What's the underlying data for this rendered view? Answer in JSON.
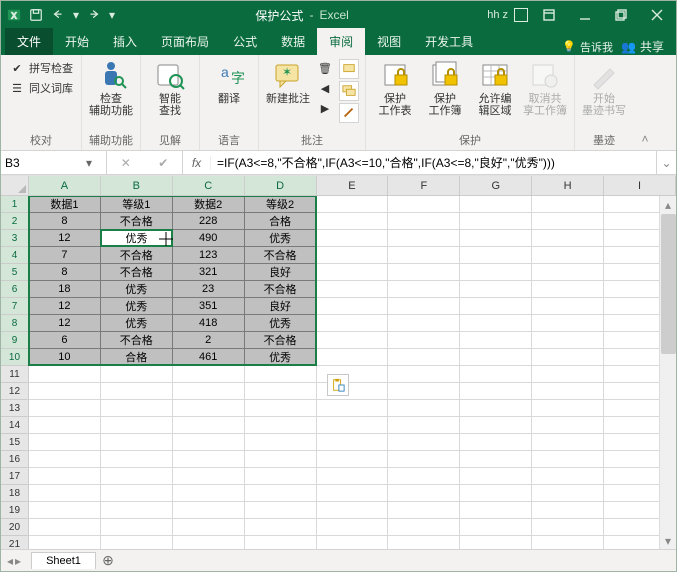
{
  "title": {
    "doc": "保护公式",
    "app": "Excel"
  },
  "user": "hh z",
  "qat": {
    "save": "save",
    "undo": "undo",
    "redo": "redo"
  },
  "win": {
    "min": "minimize",
    "max": "restore",
    "close": "close"
  },
  "tabs": {
    "file": "文件",
    "home": "开始",
    "insert": "插入",
    "layout": "页面布局",
    "formulas": "公式",
    "data": "数据",
    "review": "审阅",
    "view": "视图",
    "devtools": "开发工具",
    "tellme": "告诉我",
    "share": "共享"
  },
  "ribbon": {
    "proofing": {
      "label": "校对",
      "spelling": "拼写检查",
      "thesaurus": "同义词库"
    },
    "accessibility": {
      "label": "辅助功能",
      "check1": "检查",
      "check2": "辅助功能"
    },
    "insights": {
      "label": "见解",
      "smart1": "智能",
      "smart2": "查找"
    },
    "language": {
      "label": "语言",
      "translate": "翻译"
    },
    "comments": {
      "label": "批注",
      "new": "新建批注"
    },
    "protect": {
      "label": "保护",
      "sheet1": "保护",
      "sheet2": "工作表",
      "book1": "保护",
      "book2": "工作簿",
      "allow1": "允许编",
      "allow2": "辑区域",
      "unshare1": "取消共",
      "unshare2": "享工作簿"
    },
    "ink": {
      "label": "墨迹",
      "start1": "开始",
      "start2": "墨迹书写"
    }
  },
  "namebox": "B3",
  "formula": "=IF(A3<=8,\"不合格\",IF(A3<=10,\"合格\",IF(A3<=8,\"良好\",\"优秀\")))",
  "columns": [
    "A",
    "B",
    "C",
    "D",
    "E",
    "F",
    "G",
    "H",
    "I"
  ],
  "sel_cols": 4,
  "sel_rows": 10,
  "active": {
    "row": 3,
    "col": "B",
    "value": "优秀"
  },
  "table": [
    [
      "数据1",
      "等级1",
      "数据2",
      "等级2"
    ],
    [
      "8",
      "不合格",
      "228",
      "合格"
    ],
    [
      "12",
      "优秀",
      "490",
      "优秀"
    ],
    [
      "7",
      "不合格",
      "123",
      "不合格"
    ],
    [
      "8",
      "不合格",
      "321",
      "良好"
    ],
    [
      "18",
      "优秀",
      "23",
      "不合格"
    ],
    [
      "12",
      "优秀",
      "351",
      "良好"
    ],
    [
      "12",
      "优秀",
      "418",
      "优秀"
    ],
    [
      "6",
      "不合格",
      "2",
      "不合格"
    ],
    [
      "10",
      "合格",
      "461",
      "优秀"
    ]
  ],
  "total_rows": 22,
  "sheet": {
    "name": "Sheet1"
  }
}
